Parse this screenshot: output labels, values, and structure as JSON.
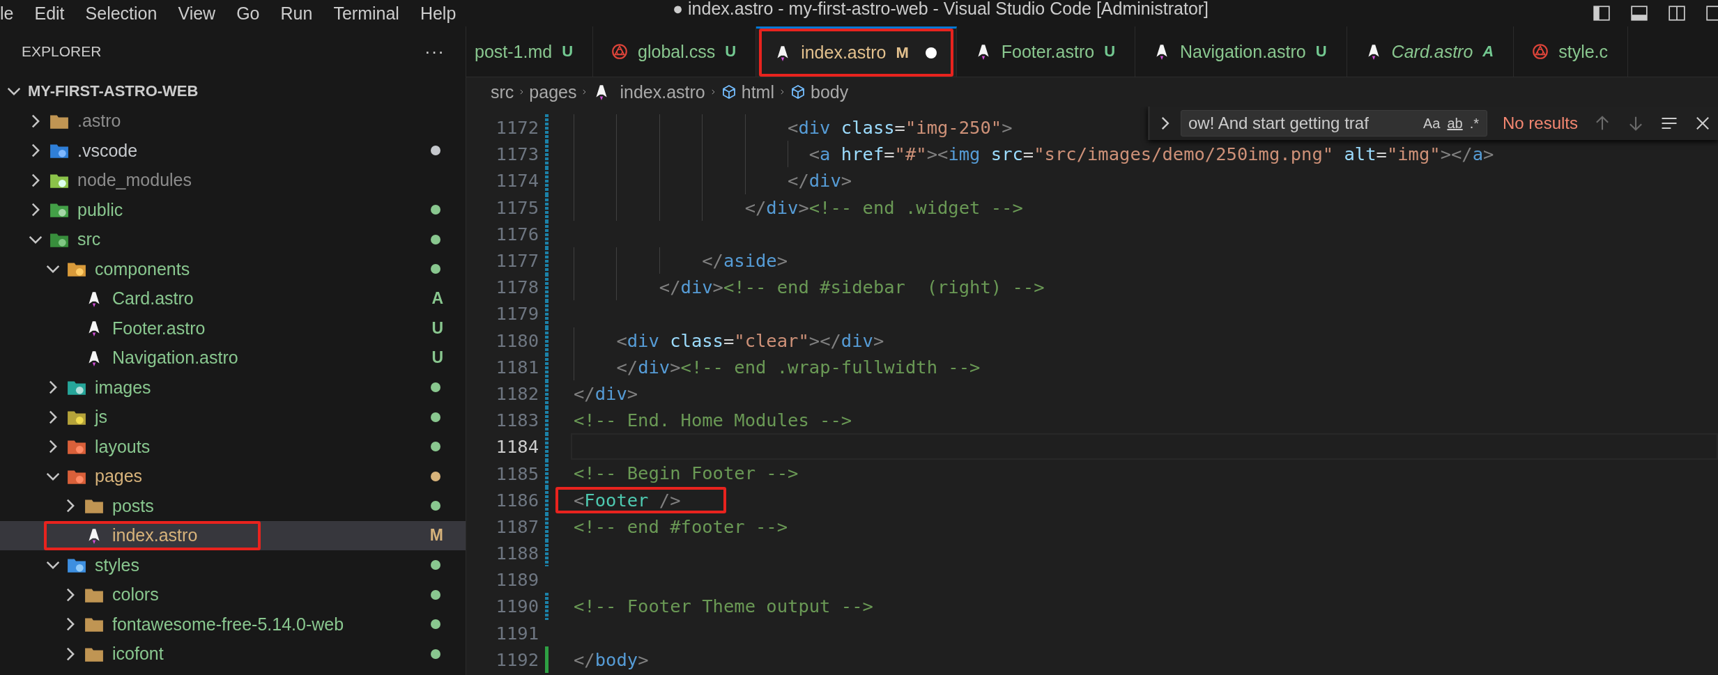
{
  "menu_bar": {
    "items": [
      "le",
      "Edit",
      "Selection",
      "View",
      "Go",
      "Run",
      "Terminal",
      "Help"
    ],
    "title": "● index.astro - my-first-astro-web - Visual Studio Code [Administrator]"
  },
  "explorer": {
    "title": "EXPLORER",
    "more": "···",
    "root": {
      "label": "MY-FIRST-ASTRO-WEB",
      "expanded": true,
      "children": [
        {
          "label": ".astro",
          "kind": "folder",
          "expanded": false,
          "selected": false,
          "highlighted": false,
          "color": "#8c8c8c"
        },
        {
          "label": ".vscode",
          "kind": "folder-vscode",
          "expanded": false,
          "selected": false,
          "highlighted": false,
          "color": "#c5c8cc",
          "dot": true
        },
        {
          "label": "node_modules",
          "kind": "folder-node",
          "expanded": false,
          "selected": false,
          "highlighted": false,
          "color": "#8c8c8c"
        },
        {
          "label": "public",
          "kind": "folder-public",
          "expanded": false,
          "selected": false,
          "highlighted": false,
          "color": "#89c78f",
          "dot": true
        },
        {
          "label": "src",
          "kind": "folder-src",
          "expanded": true,
          "selected": false,
          "highlighted": false,
          "color": "#89c78f",
          "dot": true,
          "children": [
            {
              "label": "components",
              "kind": "folder-components",
              "expanded": true,
              "selected": false,
              "highlighted": false,
              "color": "#89c78f",
              "dot": true,
              "children": [
                {
                  "label": "Card.astro",
                  "kind": "astro",
                  "selected": false,
                  "highlighted": false,
                  "color": "#89c78f",
                  "badge": "A"
                },
                {
                  "label": "Footer.astro",
                  "kind": "astro",
                  "selected": false,
                  "highlighted": false,
                  "color": "#89c78f",
                  "badge": "U"
                },
                {
                  "label": "Navigation.astro",
                  "kind": "astro",
                  "selected": false,
                  "highlighted": false,
                  "color": "#89c78f",
                  "badge": "U"
                }
              ]
            },
            {
              "label": "images",
              "kind": "folder-images",
              "expanded": false,
              "selected": false,
              "highlighted": false,
              "color": "#89c78f",
              "dot": true
            },
            {
              "label": "js",
              "kind": "folder-js",
              "expanded": false,
              "selected": false,
              "highlighted": false,
              "color": "#89c78f",
              "dot": true
            },
            {
              "label": "layouts",
              "kind": "folder-layouts",
              "expanded": false,
              "selected": false,
              "highlighted": false,
              "color": "#89c78f",
              "dot": true
            },
            {
              "label": "pages",
              "kind": "folder-pages",
              "expanded": true,
              "selected": false,
              "highlighted": false,
              "color": "#d7b37b",
              "dot": true,
              "children": [
                {
                  "label": "posts",
                  "kind": "folder",
                  "expanded": false,
                  "selected": false,
                  "highlighted": false,
                  "color": "#89c78f",
                  "dot": true
                },
                {
                  "label": "index.astro",
                  "kind": "astro",
                  "selected": true,
                  "highlighted": true,
                  "color": "#d7b37b",
                  "badge": "M"
                }
              ]
            },
            {
              "label": "styles",
              "kind": "folder-styles",
              "expanded": true,
              "selected": false,
              "highlighted": false,
              "color": "#89c78f",
              "dot": true,
              "children": [
                {
                  "label": "colors",
                  "kind": "folder",
                  "expanded": false,
                  "selected": false,
                  "highlighted": false,
                  "color": "#89c78f",
                  "dot": true
                },
                {
                  "label": "fontawesome-free-5.14.0-web",
                  "kind": "folder",
                  "expanded": false,
                  "selected": false,
                  "highlighted": false,
                  "color": "#89c78f",
                  "dot": true
                },
                {
                  "label": "icofont",
                  "kind": "folder",
                  "expanded": false,
                  "selected": false,
                  "highlighted": false,
                  "color": "#89c78f",
                  "dot": true
                }
              ]
            }
          ]
        }
      ]
    }
  },
  "tabs": [
    {
      "label": "post-1.md",
      "kind": "plain",
      "status": "U",
      "color": "#89c78f",
      "selected": false,
      "dirty": false,
      "preview": false,
      "highlighted": false
    },
    {
      "label": "global.css",
      "kind": "css",
      "status": "U",
      "color": "#89c78f",
      "selected": false,
      "dirty": false,
      "preview": false,
      "highlighted": false
    },
    {
      "label": "index.astro",
      "kind": "astro",
      "status": "M",
      "color": "#e2c08d",
      "selected": true,
      "dirty": true,
      "preview": false,
      "highlighted": true
    },
    {
      "label": "Footer.astro",
      "kind": "astro",
      "status": "U",
      "color": "#89c78f",
      "selected": false,
      "dirty": false,
      "preview": false,
      "highlighted": false
    },
    {
      "label": "Navigation.astro",
      "kind": "astro",
      "status": "U",
      "color": "#89c78f",
      "selected": false,
      "dirty": false,
      "preview": false,
      "highlighted": false
    },
    {
      "label": "Card.astro",
      "kind": "astro",
      "status": "A",
      "color": "#89c78f",
      "selected": false,
      "dirty": false,
      "preview": true,
      "highlighted": false
    },
    {
      "label": "style.c",
      "kind": "css",
      "color": "#89c78f",
      "selected": false,
      "dirty": false,
      "preview": false,
      "highlighted": false
    }
  ],
  "breadcrumb": [
    {
      "label": "src",
      "kind": "plain"
    },
    {
      "label": "pages",
      "kind": "plain"
    },
    {
      "label": "index.astro",
      "kind": "astro"
    },
    {
      "label": "html",
      "kind": "symbol"
    },
    {
      "label": "body",
      "kind": "symbol"
    }
  ],
  "find_widget": {
    "value": "ow! And start getting traf",
    "case_toggle": "Aa",
    "word_toggle": "ab",
    "regex_toggle": ".*",
    "result": "No results"
  },
  "code_lines": [
    {
      "number": "1172",
      "kind": "modified",
      "current": false,
      "highlighted": false,
      "tokens": [
        {
          "kind": "p",
          "text": "                    <"
        },
        {
          "kind": "tag",
          "text": "div"
        },
        {
          "kind": "attr",
          "text": " class"
        },
        {
          "kind": "eq",
          "text": "="
        },
        {
          "kind": "str",
          "text": "\"img-250\""
        },
        {
          "kind": "p",
          "text": ">"
        }
      ]
    },
    {
      "number": "1173",
      "kind": "modified",
      "current": false,
      "highlighted": false,
      "tokens": [
        {
          "kind": "p",
          "text": "                      <"
        },
        {
          "kind": "tag",
          "text": "a"
        },
        {
          "kind": "attr",
          "text": " href"
        },
        {
          "kind": "eq",
          "text": "="
        },
        {
          "kind": "str",
          "text": "\"#\""
        },
        {
          "kind": "p",
          "text": "><"
        },
        {
          "kind": "tag",
          "text": "img"
        },
        {
          "kind": "attr",
          "text": " src"
        },
        {
          "kind": "eq",
          "text": "="
        },
        {
          "kind": "str",
          "text": "\"src/images/demo/250img.png\""
        },
        {
          "kind": "attr",
          "text": " alt"
        },
        {
          "kind": "eq",
          "text": "="
        },
        {
          "kind": "str",
          "text": "\"img\""
        },
        {
          "kind": "p",
          "text": "></"
        },
        {
          "kind": "tag",
          "text": "a"
        },
        {
          "kind": "p",
          "text": ">"
        }
      ]
    },
    {
      "number": "1174",
      "kind": "modified",
      "current": false,
      "highlighted": false,
      "tokens": [
        {
          "kind": "p",
          "text": "                    </"
        },
        {
          "kind": "tag",
          "text": "div"
        },
        {
          "kind": "p",
          "text": ">"
        }
      ]
    },
    {
      "number": "1175",
      "kind": "modified",
      "current": false,
      "highlighted": false,
      "tokens": [
        {
          "kind": "p",
          "text": "                </"
        },
        {
          "kind": "tag",
          "text": "div"
        },
        {
          "kind": "p",
          "text": ">"
        },
        {
          "kind": "com",
          "text": "<!-- end .widget -->"
        }
      ]
    },
    {
      "number": "1176",
      "kind": "modified",
      "current": false,
      "highlighted": false
    },
    {
      "number": "1177",
      "kind": "modified",
      "current": false,
      "highlighted": false,
      "tokens": [
        {
          "kind": "p",
          "text": "            </"
        },
        {
          "kind": "tag",
          "text": "aside"
        },
        {
          "kind": "p",
          "text": ">"
        }
      ]
    },
    {
      "number": "1178",
      "kind": "modified",
      "current": false,
      "highlighted": false,
      "tokens": [
        {
          "kind": "p",
          "text": "        </"
        },
        {
          "kind": "tag",
          "text": "div"
        },
        {
          "kind": "p",
          "text": ">"
        },
        {
          "kind": "com",
          "text": "<!-- end #sidebar  (right) -->"
        }
      ]
    },
    {
      "number": "1179",
      "kind": "modified",
      "current": false,
      "highlighted": false
    },
    {
      "number": "1180",
      "kind": "modified",
      "current": false,
      "highlighted": false,
      "tokens": [
        {
          "kind": "p",
          "text": "    <"
        },
        {
          "kind": "tag",
          "text": "div"
        },
        {
          "kind": "attr",
          "text": " class"
        },
        {
          "kind": "eq",
          "text": "="
        },
        {
          "kind": "str",
          "text": "\"clear\""
        },
        {
          "kind": "p",
          "text": "></"
        },
        {
          "kind": "tag",
          "text": "div"
        },
        {
          "kind": "p",
          "text": ">"
        }
      ]
    },
    {
      "number": "1181",
      "kind": "modified",
      "current": false,
      "highlighted": false,
      "tokens": [
        {
          "kind": "p",
          "text": "    </"
        },
        {
          "kind": "tag",
          "text": "div"
        },
        {
          "kind": "p",
          "text": ">"
        },
        {
          "kind": "com",
          "text": "<!-- end .wrap-fullwidth -->"
        }
      ]
    },
    {
      "number": "1182",
      "kind": "modified",
      "current": false,
      "highlighted": false,
      "tokens": [
        {
          "kind": "p",
          "text": "</"
        },
        {
          "kind": "tag",
          "text": "div"
        },
        {
          "kind": "p",
          "text": ">"
        }
      ]
    },
    {
      "number": "1183",
      "kind": "modified",
      "current": false,
      "highlighted": false,
      "tokens": [
        {
          "kind": "com",
          "text": "<!-- End. Home Modules -->"
        }
      ]
    },
    {
      "number": "1184",
      "kind": "modified",
      "current": true,
      "highlighted": false
    },
    {
      "number": "1185",
      "kind": "modified",
      "current": false,
      "highlighted": false,
      "tokens": [
        {
          "kind": "com",
          "text": "<!-- Begin Footer -->"
        }
      ]
    },
    {
      "number": "1186",
      "kind": "modified",
      "current": false,
      "highlighted": true,
      "tokens": [
        {
          "kind": "p",
          "text": "<"
        },
        {
          "kind": "comp",
          "text": "Footer"
        },
        {
          "kind": "p",
          "text": " />"
        }
      ]
    },
    {
      "number": "1187",
      "kind": "modified",
      "current": false,
      "highlighted": false,
      "tokens": [
        {
          "kind": "com",
          "text": "<!-- end #footer -->"
        }
      ]
    },
    {
      "number": "1188",
      "kind": "modified",
      "current": false,
      "highlighted": false
    },
    {
      "number": "1189",
      "kind": "unchanged",
      "current": false,
      "highlighted": false
    },
    {
      "number": "1190",
      "kind": "modified",
      "current": false,
      "highlighted": false,
      "tokens": [
        {
          "kind": "com",
          "text": "<!-- Footer Theme output -->"
        }
      ]
    },
    {
      "number": "1191",
      "kind": "unchanged",
      "current": false,
      "highlighted": false
    },
    {
      "number": "1192",
      "kind": "added",
      "current": false,
      "highlighted": false,
      "tokens": [
        {
          "kind": "p",
          "text": "</"
        },
        {
          "kind": "tag",
          "text": "body"
        },
        {
          "kind": "p",
          "text": ">"
        }
      ]
    }
  ]
}
